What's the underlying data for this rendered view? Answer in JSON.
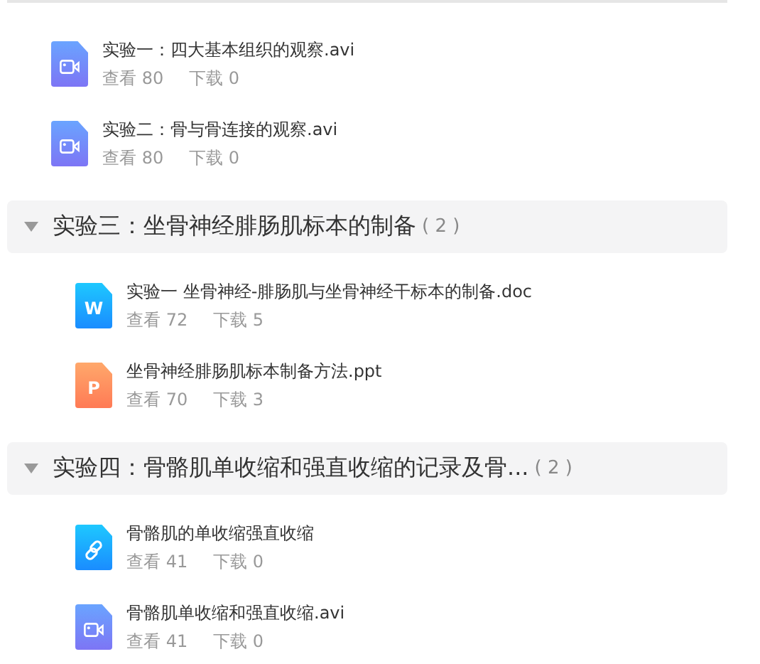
{
  "files": [
    {
      "kind": "video",
      "name": "实验一：四大基本组织的观察.avi",
      "views": "查看 80",
      "downloads": "下载 0"
    },
    {
      "kind": "video",
      "name": "实验二：骨与骨连接的观察.avi",
      "views": "查看 80",
      "downloads": "下载 0"
    }
  ],
  "sections": [
    {
      "title": "实验三：坐骨神经腓肠肌标本的制备",
      "count": "( 2 )",
      "expanded": true,
      "files": [
        {
          "kind": "doc",
          "icon_text": "W",
          "name": "实验一 坐骨神经-腓肠肌与坐骨神经干标本的制备.doc",
          "views": "查看 72",
          "downloads": "下载 5"
        },
        {
          "kind": "ppt",
          "icon_text": "P",
          "name": "坐骨神经腓肠肌标本制备方法.ppt",
          "views": "查看 70",
          "downloads": "下载 3"
        }
      ]
    },
    {
      "title": "实验四：骨骼肌单收缩和强直收缩的记录及骨...",
      "count": "( 2 )",
      "expanded": true,
      "files": [
        {
          "kind": "link",
          "name": "骨骼肌的单收缩强直收缩",
          "views": "查看 41",
          "downloads": "下载 0"
        },
        {
          "kind": "video",
          "name": "骨骼肌单收缩和强直收缩.avi",
          "views": "查看 41",
          "downloads": "下载 0"
        }
      ]
    }
  ]
}
